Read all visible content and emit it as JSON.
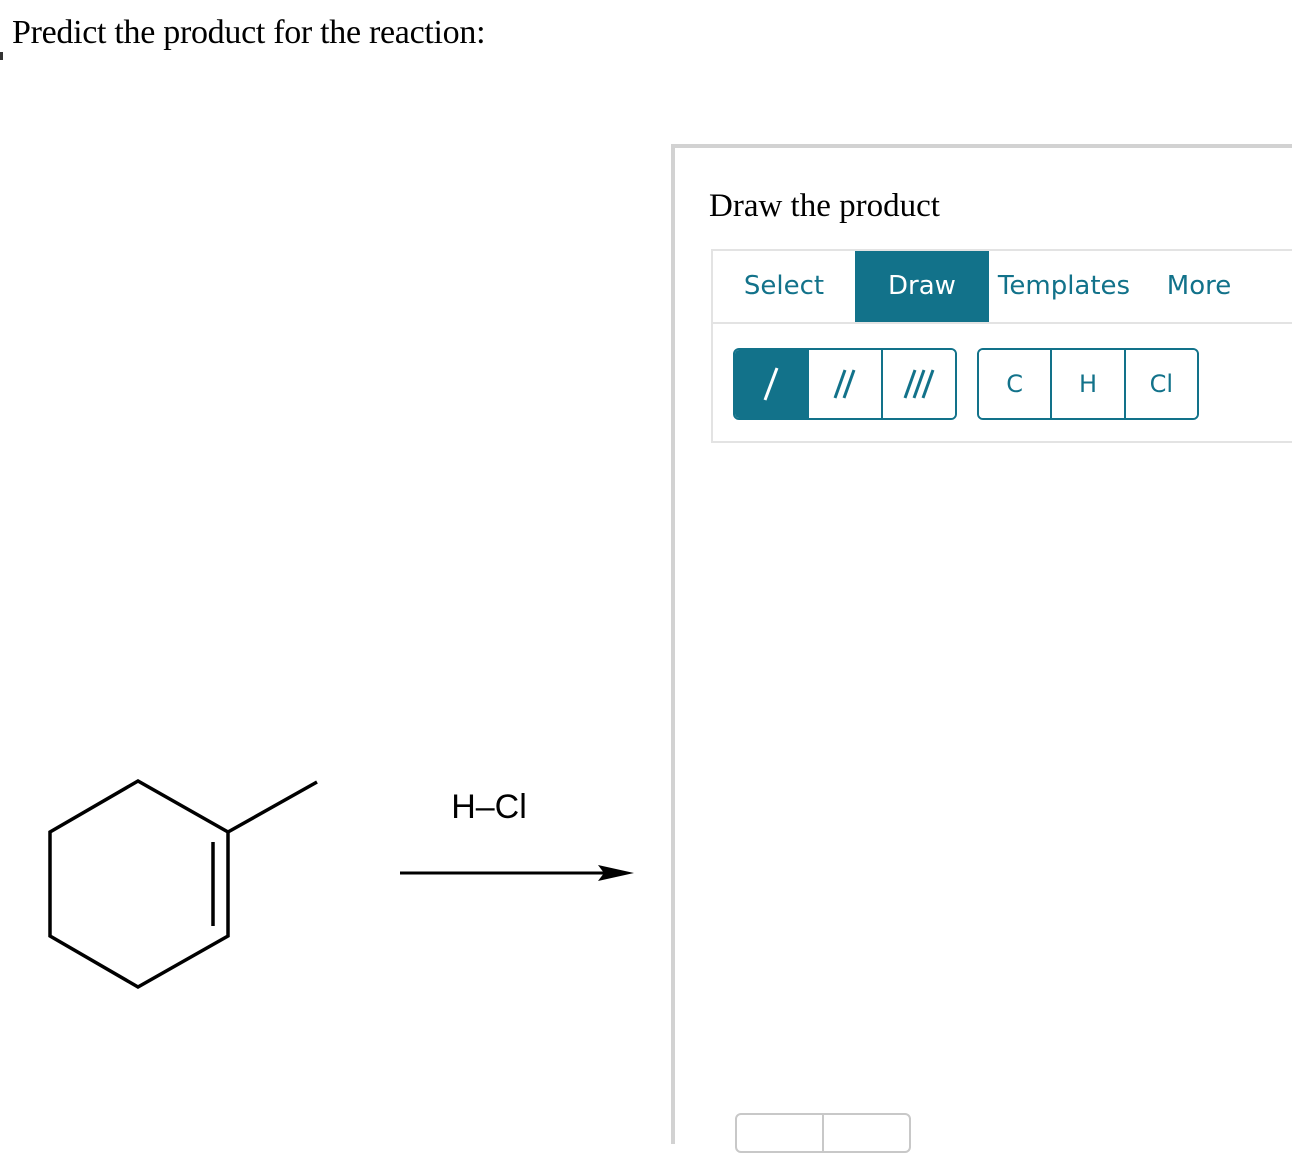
{
  "question": {
    "text": "Predict the product for the reaction:"
  },
  "reaction": {
    "reagent": "H–Cl"
  },
  "panel": {
    "title": "Draw the product",
    "tabs": [
      {
        "label": "Select",
        "active": false
      },
      {
        "label": "Draw",
        "active": true
      },
      {
        "label": "Templates",
        "active": false
      },
      {
        "label": "More",
        "active": false
      }
    ],
    "bond_tools": [
      {
        "name": "single-bond",
        "active": true
      },
      {
        "name": "double-bond",
        "active": false
      },
      {
        "name": "triple-bond",
        "active": false
      }
    ],
    "atoms": [
      "C",
      "H",
      "Cl"
    ],
    "accent_color": "#12728a"
  }
}
